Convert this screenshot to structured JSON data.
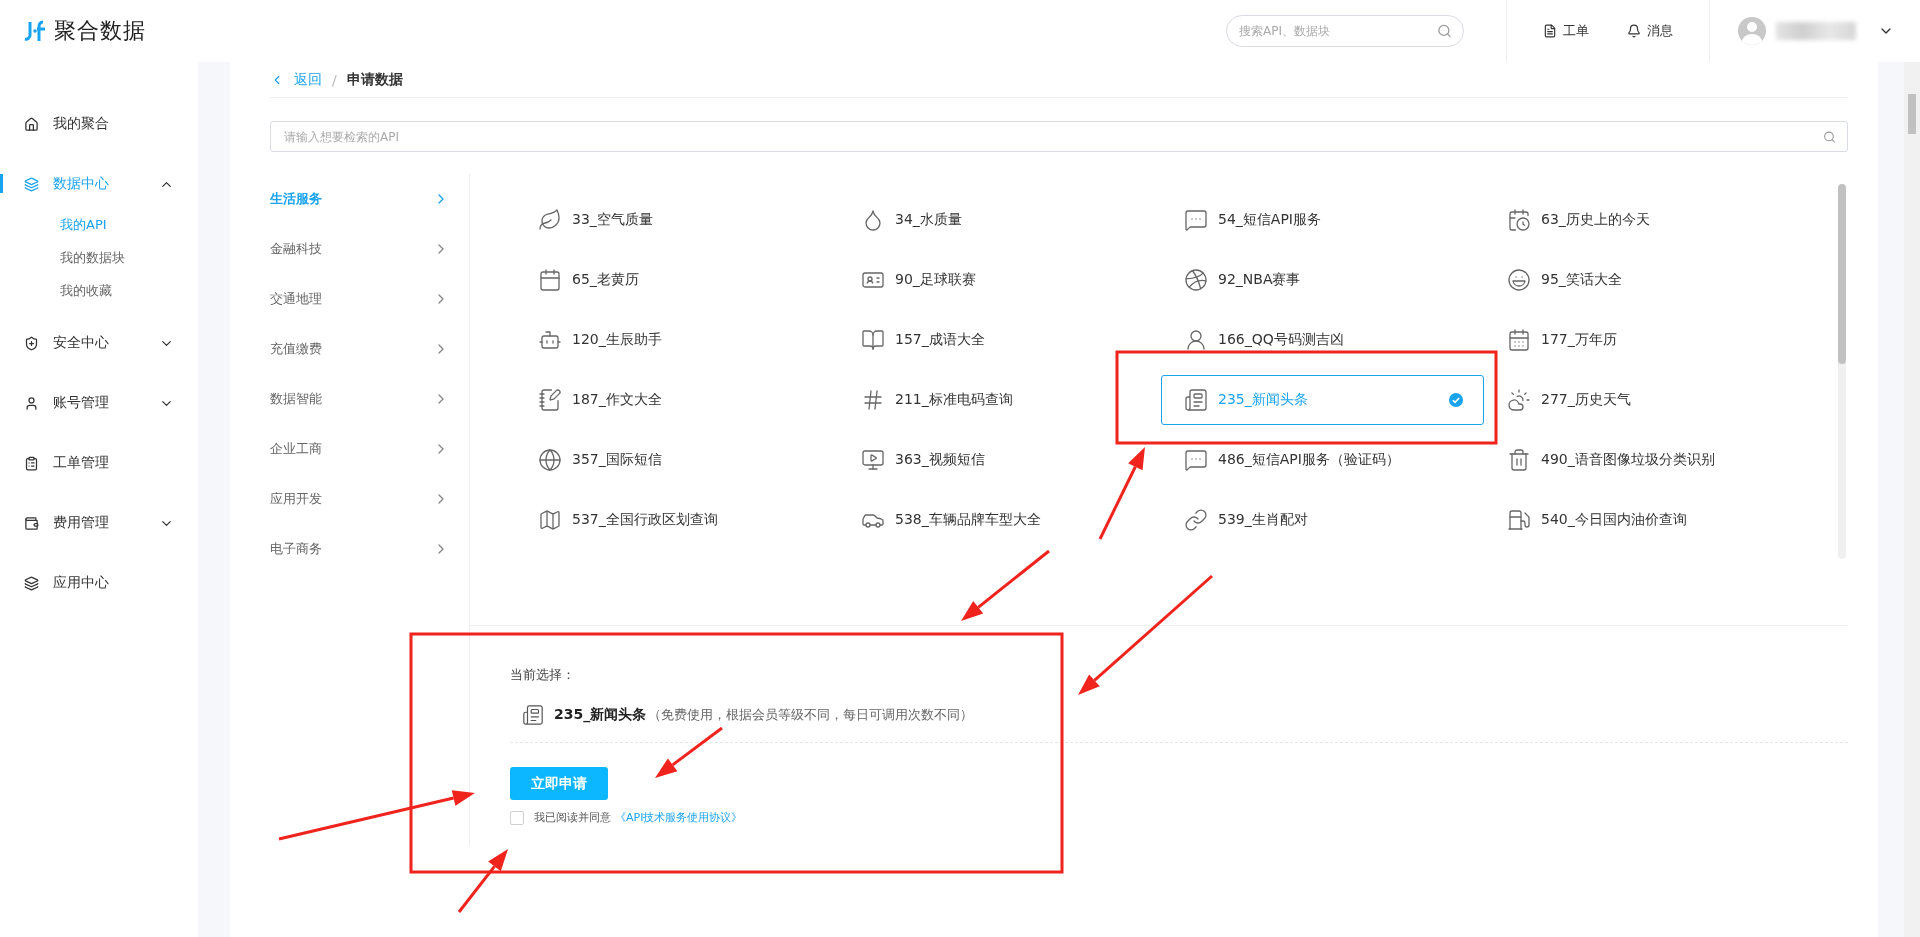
{
  "header": {
    "logo": "聚合数据",
    "search": {
      "placeholder": "搜索API、数据块"
    },
    "links": [
      "工单",
      "消息"
    ]
  },
  "sidebar": {
    "items": [
      {
        "label": "我的聚合",
        "kind": "link",
        "selected": false
      },
      {
        "label": "数据中心",
        "kind": "group",
        "selected": true,
        "expanded": true,
        "children": [
          {
            "label": "我的API",
            "selected": true
          },
          {
            "label": "我的数据块",
            "selected": false
          },
          {
            "label": "我的收藏",
            "selected": false
          }
        ]
      },
      {
        "label": "安全中心",
        "kind": "group",
        "selected": false,
        "expanded": false
      },
      {
        "label": "账号管理",
        "kind": "group",
        "selected": false,
        "expanded": false
      },
      {
        "label": "工单管理",
        "kind": "link",
        "selected": false
      },
      {
        "label": "费用管理",
        "kind": "group",
        "selected": false,
        "expanded": false
      },
      {
        "label": "应用中心",
        "kind": "link",
        "selected": false
      }
    ]
  },
  "breadcrumb": {
    "back": "返回",
    "separator": "/",
    "current": "申请数据"
  },
  "api_search": {
    "placeholder": "请输入想要检索的API"
  },
  "categories": [
    {
      "label": "生活服务",
      "selected": true
    },
    {
      "label": "金融科技",
      "selected": false
    },
    {
      "label": "交通地理",
      "selected": false
    },
    {
      "label": "充值缴费",
      "selected": false
    },
    {
      "label": "数据智能",
      "selected": false
    },
    {
      "label": "企业工商",
      "selected": false
    },
    {
      "label": "应用开发",
      "selected": false
    },
    {
      "label": "电子商务",
      "selected": false
    }
  ],
  "apis": [
    {
      "label": "33_空气质量",
      "selected": false
    },
    {
      "label": "34_水质量",
      "selected": false
    },
    {
      "label": "54_短信API服务",
      "selected": false
    },
    {
      "label": "63_历史上的今天",
      "selected": false
    },
    {
      "label": "65_老黄历",
      "selected": false
    },
    {
      "label": "90_足球联赛",
      "selected": false
    },
    {
      "label": "92_NBA赛事",
      "selected": false
    },
    {
      "label": "95_笑话大全",
      "selected": false
    },
    {
      "label": "120_生辰助手",
      "selected": false
    },
    {
      "label": "157_成语大全",
      "selected": false
    },
    {
      "label": "166_QQ号码测吉凶",
      "selected": false
    },
    {
      "label": "177_万年历",
      "selected": false
    },
    {
      "label": "187_作文大全",
      "selected": false
    },
    {
      "label": "211_标准电码查询",
      "selected": false
    },
    {
      "label": "235_新闻头条",
      "selected": true
    },
    {
      "label": "277_历史天气",
      "selected": false
    },
    {
      "label": "357_国际短信",
      "selected": false
    },
    {
      "label": "363_视频短信",
      "selected": false
    },
    {
      "label": "486_短信API服务（验证码）",
      "selected": false
    },
    {
      "label": "490_语音图像垃圾分类识别",
      "selected": false
    },
    {
      "label": "537_全国行政区划查询",
      "selected": false
    },
    {
      "label": "538_车辆品牌车型大全",
      "selected": false
    },
    {
      "label": "539_生肖配对",
      "selected": false
    },
    {
      "label": "540_今日国内油价查询",
      "selected": false
    }
  ],
  "selection": {
    "heading": "当前选择：",
    "name": "235_新闻头条",
    "note": "（免费使用，根据会员等级不同，每日可调用次数不同）",
    "button": "立即申请",
    "agreement": {
      "checked": false,
      "label": "我已阅读并同意",
      "link": "《API技术服务使用协议》"
    }
  }
}
